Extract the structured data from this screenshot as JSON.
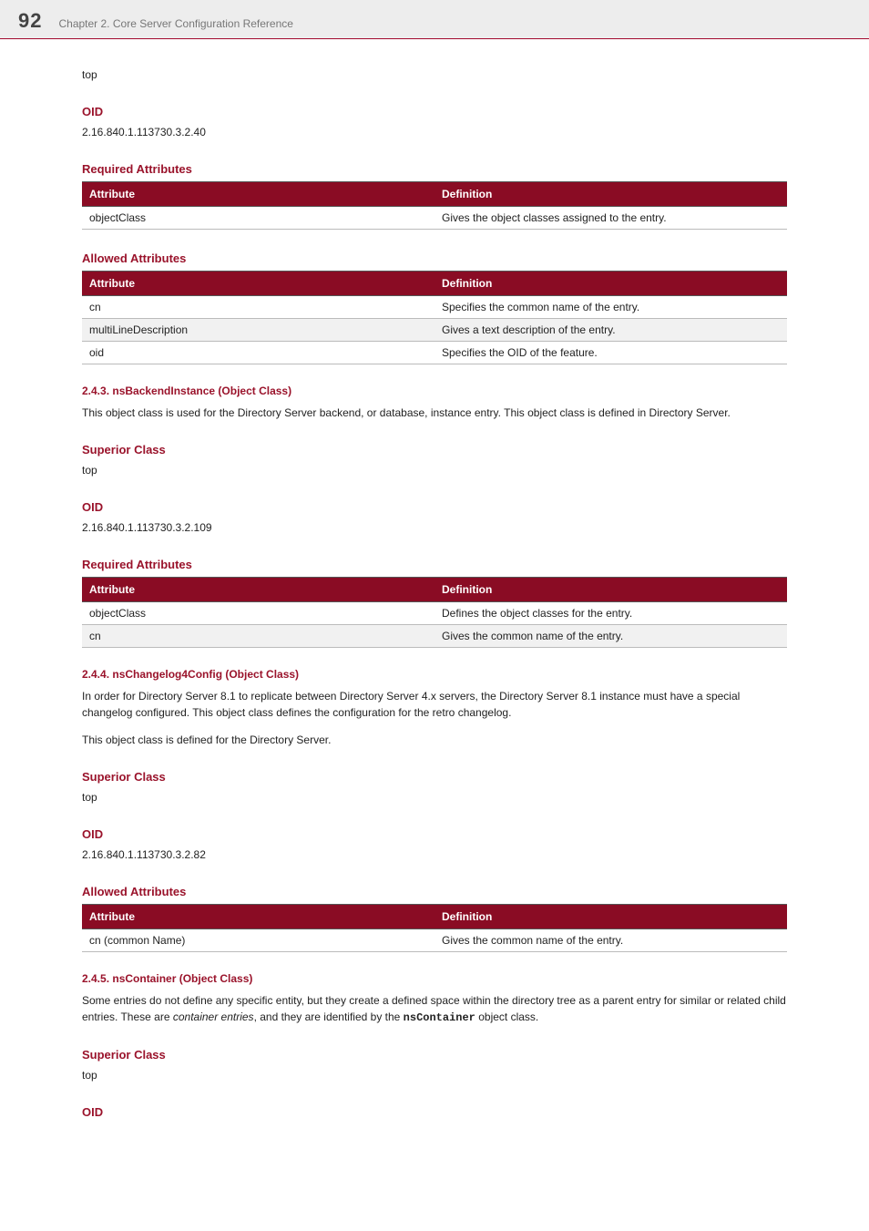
{
  "header": {
    "page_number": "92",
    "chapter": "Chapter 2. Core Server Configuration Reference"
  },
  "labels": {
    "attribute": "Attribute",
    "definition": "Definition",
    "superior_class": "Superior Class",
    "oid": "OID",
    "required_attributes": "Required Attributes",
    "allowed_attributes": "Allowed Attributes",
    "top": "top"
  },
  "intro_top": "top",
  "section_a": {
    "oid_value": "2.16.840.1.113730.3.2.40",
    "required": {
      "rows": [
        {
          "attr": "objectClass",
          "def": "Gives the object classes assigned to the entry."
        }
      ]
    },
    "allowed": {
      "rows": [
        {
          "attr": "cn",
          "def": "Specifies the common name of the entry."
        },
        {
          "attr": "multiLineDescription",
          "def": "Gives a text description of the entry."
        },
        {
          "attr": "oid",
          "def": "Specifies the OID of the feature."
        }
      ]
    }
  },
  "section_243": {
    "heading": "2.4.3. nsBackendInstance (Object Class)",
    "desc": "This object class is used for the Directory Server backend, or database, instance entry. This object class is defined in Directory Server.",
    "superior": "top",
    "oid_value": "2.16.840.1.113730.3.2.109",
    "required": {
      "rows": [
        {
          "attr": "objectClass",
          "def": "Defines the object classes for the entry."
        },
        {
          "attr": "cn",
          "def": "Gives the common name of the entry."
        }
      ]
    }
  },
  "section_244": {
    "heading": "2.4.4. nsChangelog4Config (Object Class)",
    "desc": "In order for Directory Server 8.1 to replicate between Directory Server 4.x servers, the Directory Server 8.1 instance must have a special changelog configured. This object class defines the configuration for the retro changelog.",
    "desc2": "This object class is defined for the Directory Server.",
    "superior": "top",
    "oid_value": "2.16.840.1.113730.3.2.82",
    "allowed": {
      "rows": [
        {
          "attr": "cn (common Name)",
          "def": "Gives the common name of the entry."
        }
      ]
    }
  },
  "section_245": {
    "heading": "2.4.5. nsContainer (Object Class)",
    "desc_pre": "Some entries do not define any specific entity, but they create a defined space within the directory tree as a parent entry for similar or related child entries. These are ",
    "desc_em": "container entries",
    "desc_mid": ", and they are identified by the ",
    "desc_code": "nsContainer",
    "desc_post": " object class.",
    "superior": "top"
  }
}
